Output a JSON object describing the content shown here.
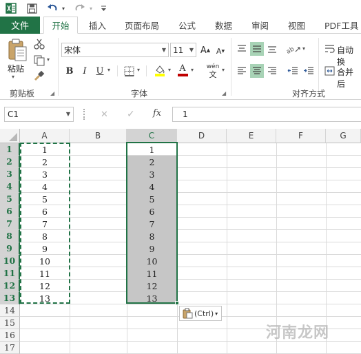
{
  "tabs": {
    "file": "文件",
    "home": "开始",
    "insert": "插入",
    "layout": "页面布局",
    "formulas": "公式",
    "data": "数据",
    "review": "审阅",
    "view": "视图",
    "pdf": "PDF工具"
  },
  "ribbon": {
    "paste_label": "粘贴",
    "clipboard_label": "剪贴板",
    "font_name": "宋体",
    "font_size": "11",
    "font_label": "字体",
    "bold": "B",
    "italic": "I",
    "underline": "U",
    "font_color_letter": "A",
    "grow_font": "A",
    "shrink_font": "A",
    "phonetic": "wén",
    "phonetic_char": "文",
    "wrap_text": "自动换",
    "merge_center": "合并后",
    "align_label": "对齐方式",
    "orient_symbol": "ab"
  },
  "formula_bar": {
    "name_box": "C1",
    "cancel": "✕",
    "enter": "✓",
    "fx": "fx",
    "content": "1"
  },
  "columns": [
    "A",
    "B",
    "C",
    "D",
    "E",
    "F",
    "G"
  ],
  "rows": [
    "1",
    "2",
    "3",
    "4",
    "5",
    "6",
    "7",
    "8",
    "9",
    "10",
    "11",
    "12",
    "13",
    "14",
    "15",
    "16",
    "17"
  ],
  "column_a_values": [
    "1",
    "2",
    "3",
    "4",
    "5",
    "6",
    "7",
    "8",
    "9",
    "10",
    "11",
    "12",
    "13"
  ],
  "column_c_values": [
    "1",
    "2",
    "3",
    "4",
    "5",
    "6",
    "7",
    "8",
    "9",
    "10",
    "11",
    "12",
    "13"
  ],
  "paste_options_label": "(Ctrl)",
  "watermark": "河南龙网",
  "colors": {
    "accent": "#217346",
    "selection": "#c6c6c6",
    "highlight": "#a8d3b6",
    "font_color": "#c00000",
    "fill_color": "#ffff00"
  }
}
